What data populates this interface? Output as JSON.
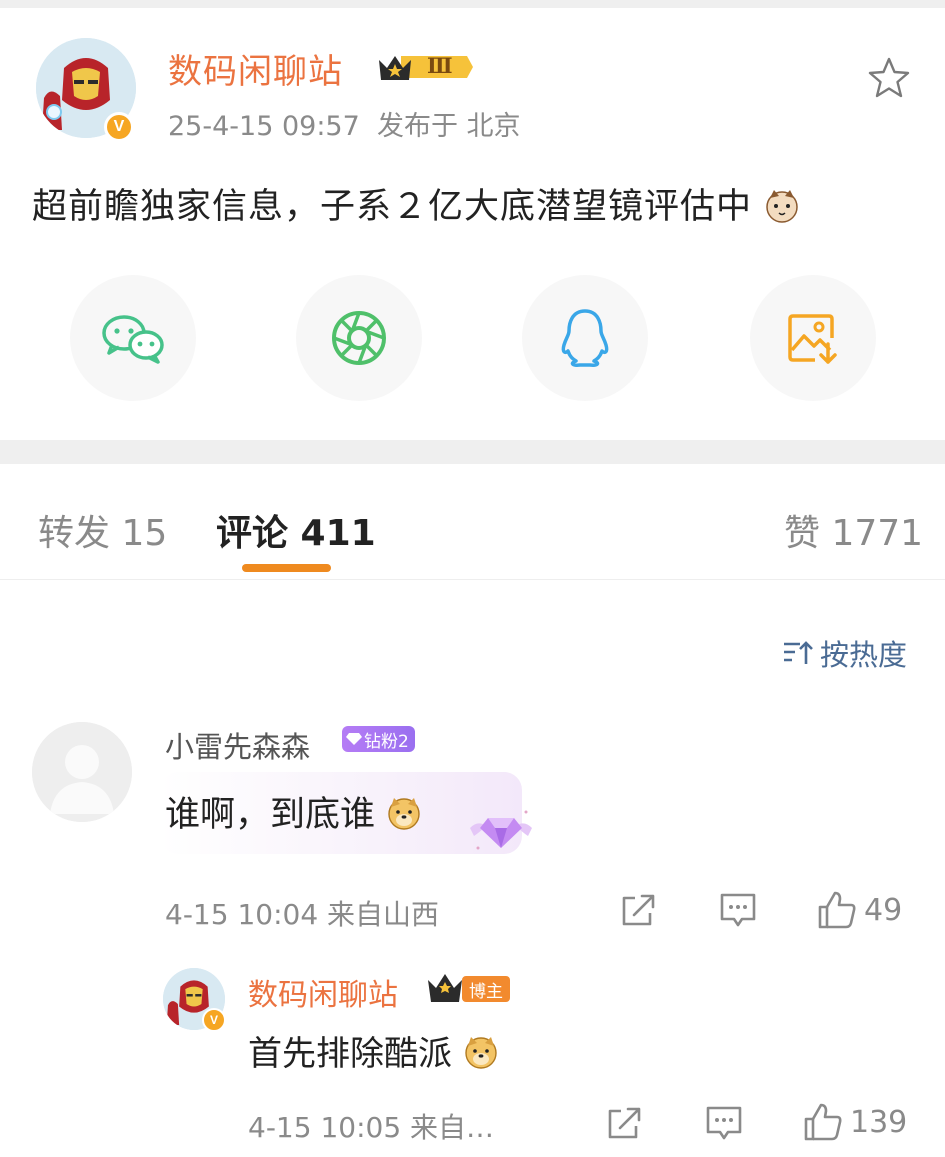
{
  "post": {
    "author": "数码闲聊站",
    "level_badge": "Ⅲ",
    "time": "25-4-15 09:57",
    "location": "发布于 北京",
    "content": "超前瞻独家信息，子系２亿大底潜望镜评估中",
    "content_emoji": "cat-emoji",
    "verified_mark": "V"
  },
  "share": {
    "items": [
      {
        "name": "wechat",
        "icon": "wechat-icon",
        "color": "#46c28a"
      },
      {
        "name": "moments",
        "icon": "moments-icon",
        "color": "#4fc06a"
      },
      {
        "name": "qq",
        "icon": "qq-icon",
        "color": "#3aa7e8"
      },
      {
        "name": "save-image",
        "icon": "save-image-icon",
        "color": "#f5a623"
      }
    ]
  },
  "tabs": {
    "repost": "转发 15",
    "comments": "评论 411",
    "likes": "赞 1771"
  },
  "sort": {
    "label": "按热度"
  },
  "comment": {
    "name": "小雷先森森",
    "fan_badge": "钻粉2",
    "text": "谁啊，到底谁",
    "time": "4-15 10:04",
    "source": "来自山西",
    "like_count": "49"
  },
  "reply": {
    "name": "数码闲聊站",
    "role_badge": "博主",
    "text": "首先排除酷派",
    "time": "4-15 10:05",
    "source": "来自…",
    "like_count": "139"
  },
  "colors": {
    "accent": "#eb7340",
    "tab_underline": "#ef8a1f",
    "sort": "#4a6b94"
  }
}
